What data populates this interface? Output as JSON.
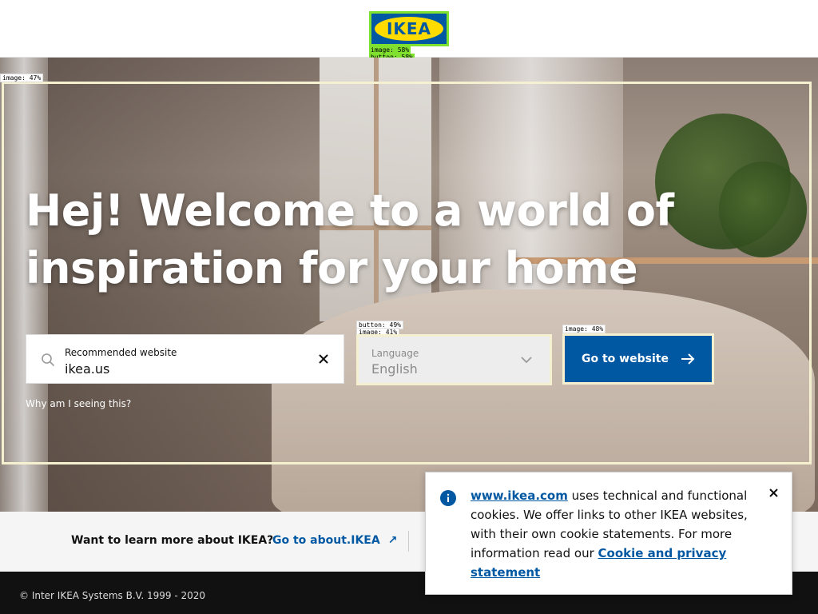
{
  "header": {
    "logo_text": "IKEA",
    "logo_tags": [
      "image: 58%",
      "button: 58%"
    ]
  },
  "hero": {
    "image_tag": "image: 47%",
    "headline_line1": "Hej! Welcome to a world of",
    "headline_line2": "inspiration for your home",
    "site_field": {
      "label": "Recommended website",
      "value": "ikea.us",
      "clear_icon": "close-icon"
    },
    "language_field": {
      "label": "Language",
      "value": "English",
      "tags": [
        "button: 49%",
        "image: 41%"
      ]
    },
    "go_button": {
      "label": "Go to website",
      "tag": "image: 48%"
    },
    "why_link": "Why am I seeing this?"
  },
  "learn_more": {
    "question": "Want to learn more about IKEA?",
    "link": "Go to about.IKEA",
    "arrow": "↗"
  },
  "footer": {
    "copyright": "© Inter IKEA Systems B.V. 1999 - 2020"
  },
  "cookie": {
    "link1": "www.ikea.com",
    "text1": " uses technical and functional cookies. We offer links to other IKEA websites, with their own cookie statements. For more information read our ",
    "link2": "Cookie and privacy statement",
    "close": "×"
  },
  "colors": {
    "brand_blue": "#0058a3",
    "brand_yellow": "#ffdb00",
    "footer_bg": "#111111"
  }
}
